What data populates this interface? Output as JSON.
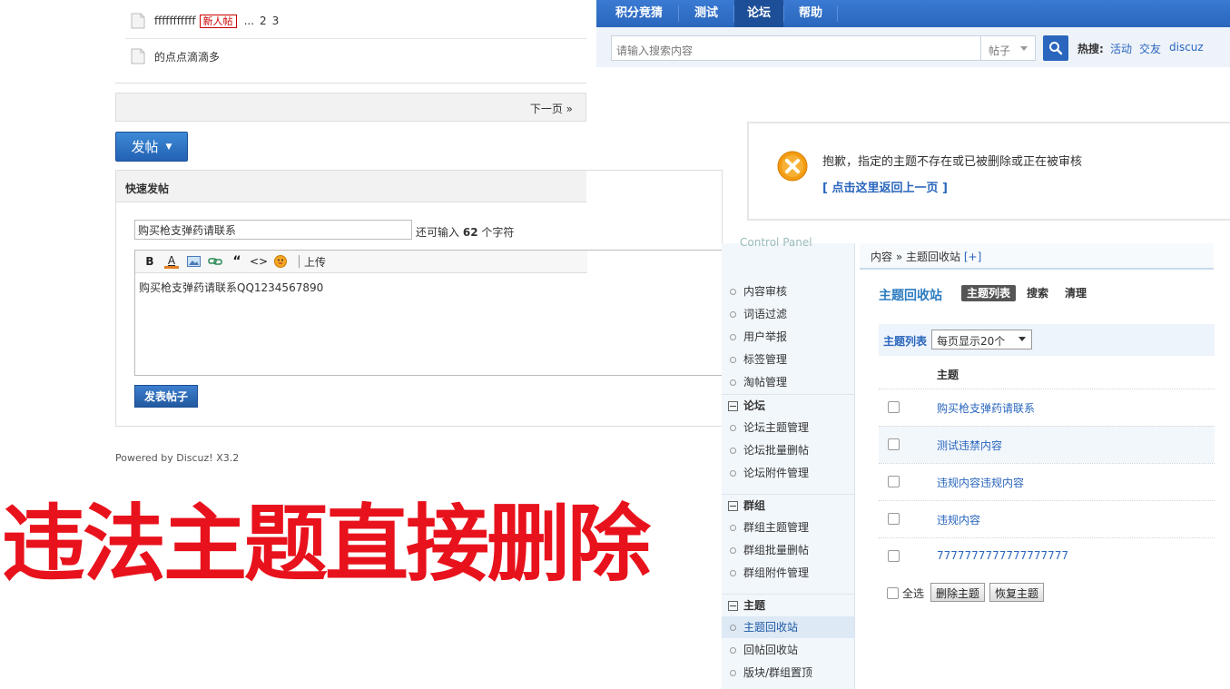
{
  "forum": {
    "threads": [
      {
        "title": "fffffffffff",
        "badge": "新人帖",
        "pages": [
          "...",
          "2",
          "3"
        ]
      },
      {
        "title": "的点点滴滴多",
        "badge": "",
        "pages": []
      }
    ],
    "next_page": "下一页 »",
    "post_button": "发帖",
    "quick_post": {
      "heading": "快速发帖",
      "subject_value": "购买枪支弹药请联系",
      "remain_prefix": "还可输入",
      "remain_count": "62",
      "remain_suffix": "个字符",
      "toolbar_bold": "B",
      "toolbar_font": "A",
      "toolbar_quote": "“",
      "toolbar_code": "<>",
      "toolbar_upload": "上传",
      "body": "购买枪支弹药请联系QQ1234567890",
      "submit": "发表帖子"
    },
    "footer": "Powered by Discuz! X3.2"
  },
  "topnav": {
    "items": [
      "积分竞猜",
      "测试",
      "论坛",
      "帮助"
    ],
    "active_index": 2
  },
  "search": {
    "placeholder": "请输入搜索内容",
    "type": "帖子",
    "hot_label": "热搜:",
    "hot_links": [
      "活动",
      "交友",
      "discuz"
    ]
  },
  "error": {
    "message": "抱歉，指定的主题不存在或已被删除或正在被审核",
    "back_link": "[ 点击这里返回上一页 ]",
    "icon_color": "#f39c12"
  },
  "admin": {
    "ghost_title": "Control Panel",
    "breadcrumb": {
      "part1": "内容",
      "sep": "»",
      "part2": "主题回收站",
      "plus": "[+]"
    },
    "sidebar": {
      "items_top": [
        "内容审核",
        "词语过滤",
        "用户举报",
        "标签管理",
        "淘帖管理"
      ],
      "group_forum": "论坛",
      "items_forum": [
        "论坛主题管理",
        "论坛批量删帖",
        "论坛附件管理"
      ],
      "group_group": "群组",
      "items_group": [
        "群组主题管理",
        "群组批量删帖",
        "群组附件管理"
      ],
      "group_thread": "主题",
      "items_thread": [
        "主题回收站",
        "回帖回收站",
        "版块/群组置顶"
      ]
    },
    "module_title": "主题回收站",
    "tabs": [
      "主题列表",
      "搜索",
      "清理"
    ],
    "list_label": "主题列表",
    "per_page": "每页显示20个",
    "column_header": "主题",
    "rows": [
      "购买枪支弹药请联系",
      "测试违禁内容",
      "违规内容违规内容",
      "违规内容",
      "7777777777777777777"
    ],
    "select_all": "全选",
    "delete_button": "删除主题",
    "restore_button": "恢复主题"
  },
  "overlay": {
    "caption": "违法主题直接删除",
    "color": "#e8121c"
  }
}
